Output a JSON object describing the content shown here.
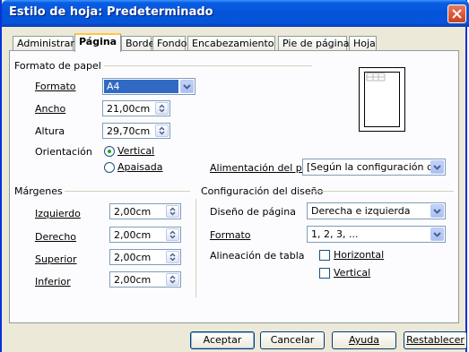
{
  "window": {
    "title": "Estilo de hoja: Predeterminado",
    "close_label": "close"
  },
  "tabs": [
    {
      "label": "Administrar",
      "active": false
    },
    {
      "label": "Página",
      "active": true
    },
    {
      "label": "Borde",
      "active": false
    },
    {
      "label": "Fondo",
      "active": false
    },
    {
      "label": "Encabezamiento",
      "active": false
    },
    {
      "label": "Pie de página",
      "active": false
    },
    {
      "label": "Hoja",
      "active": false
    }
  ],
  "paper": {
    "group_label": "Formato de papel",
    "format_label": "Formato",
    "format_value": "A4",
    "width_label": "Ancho",
    "width_value": "21,00cm",
    "height_label": "Altura",
    "height_value": "29,70cm",
    "orientation_label": "Orientación",
    "portrait_label": "Vertical",
    "landscape_label": "Apaisada",
    "orientation_selected": "Vertical",
    "paper_tray_label": "Alimentación del pap",
    "paper_tray_value": "[Según la configuración de la"
  },
  "margins": {
    "group_label": "Márgenes",
    "left_label": "Izquierdo",
    "left_value": "2,00cm",
    "right_label": "Derecho",
    "right_value": "2,00cm",
    "top_label": "Superior",
    "top_value": "2,00cm",
    "bottom_label": "Inferior",
    "bottom_value": "2,00cm"
  },
  "layout": {
    "group_label": "Configuración del diseño",
    "page_layout_label": "Diseño de página",
    "page_layout_value": "Derecha e izquierda",
    "format_label": "Formato",
    "format_value": "1, 2, 3, ...",
    "table_alignment_label": "Alineación de tabla",
    "horizontal_label": "Horizontal",
    "horizontal_checked": false,
    "vertical_label": "Vertical",
    "vertical_checked": false
  },
  "buttons": {
    "ok": "Aceptar",
    "cancel": "Cancelar",
    "help": "Ayuda",
    "reset": "Restablecer"
  },
  "colors": {
    "titlebar": "#0453d7",
    "dialog_bg": "#ece9d8",
    "panel_bg": "#fcfcfe",
    "selected_combo": "#316ac5",
    "tab_highlight": "#ffc83c"
  }
}
